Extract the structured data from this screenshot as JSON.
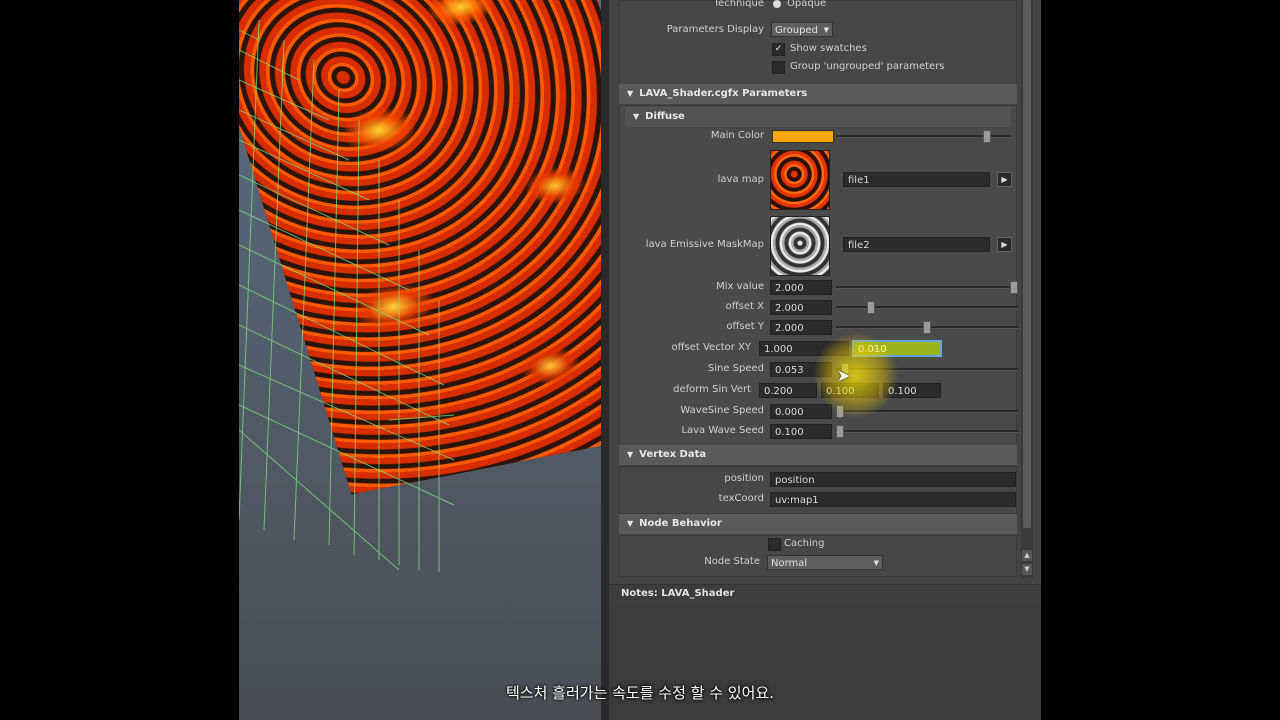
{
  "top": {
    "technique_label": "Technique",
    "technique_value": "Opaque",
    "params_display_label": "Parameters Display",
    "params_display_value": "Grouped",
    "show_swatches_label": "Show swatches",
    "group_ungrouped_label": "Group 'ungrouped' parameters"
  },
  "sections": {
    "shader": "LAVA_Shader.cgfx Parameters",
    "diffuse": "Diffuse",
    "vertex_data": "Vertex Data",
    "node_behavior": "Node Behavior"
  },
  "diffuse": {
    "main_color_label": "Main Color",
    "main_color_hex": "#f5a70a",
    "main_color_level": 0.86,
    "lava_map_label": "lava map",
    "lava_map_file": "file1",
    "emissive_label": "lava Emissive MaskMap",
    "emissive_file": "file2",
    "mix_label": "Mix value",
    "mix_value": "2.000",
    "mix_level": 0.99,
    "offx_label": "offset X",
    "offx_value": "2.000",
    "offx_level": 0.19,
    "offy_label": "offset Y",
    "offy_value": "2.000",
    "offy_level": 0.5,
    "offvec_label": "offset Vector XY",
    "offvec_x": "1.000",
    "offvec_y": "0.010",
    "sine_label": "Sine Speed",
    "sine_value": "0.053",
    "sine_level": 0.05,
    "deform_label": "deform Sin Vert",
    "deform_a": "0.200",
    "deform_b": "0.100",
    "deform_c": "0.100",
    "wavesine_label": "WaveSine Speed",
    "wavesine_value": "0.000",
    "wavesine_level": 0.0,
    "seed_label": "Lava Wave Seed",
    "seed_value": "0.100",
    "seed_level": 0.0
  },
  "vertex": {
    "position_label": "position",
    "position_value": "position",
    "texcoord_label": "texCoord",
    "texcoord_value": "uv:map1"
  },
  "node": {
    "caching_label": "Caching",
    "node_state_label": "Node State",
    "node_state_value": "Normal"
  },
  "notes": {
    "title": "Notes:  LAVA_Shader"
  },
  "subtitle": "텍스처 흘러가는 속도를 수정 할 수 있어요."
}
